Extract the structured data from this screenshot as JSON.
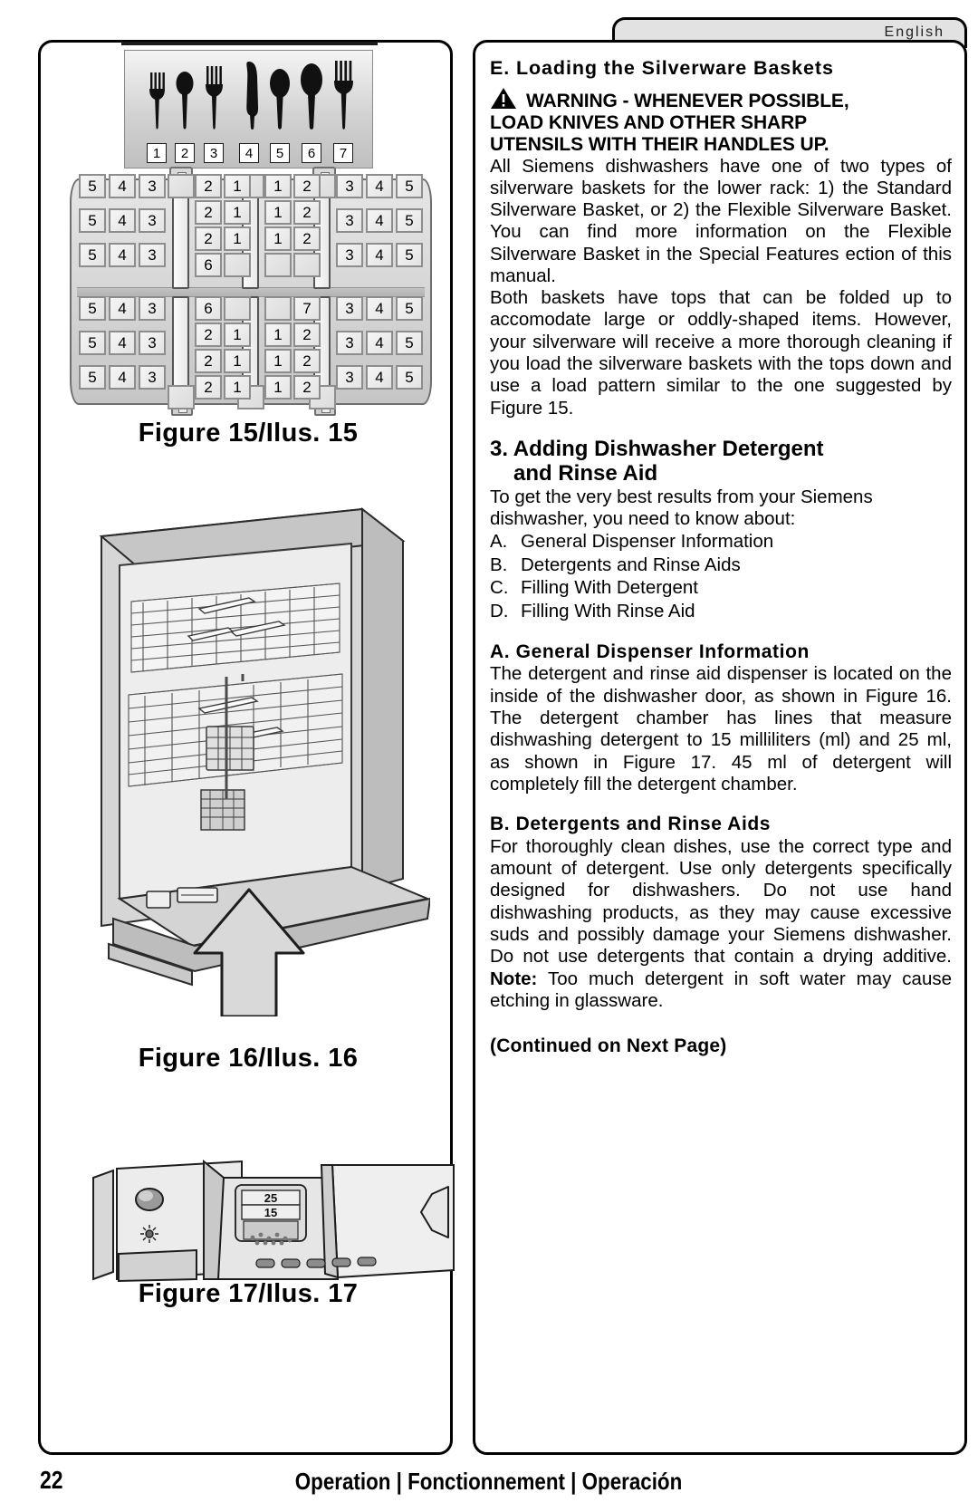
{
  "language_tab": {
    "label": "English"
  },
  "left_column": {
    "figure15": {
      "caption": "Figure 15/Ilus. 15",
      "utensil_key": {
        "items": [
          {
            "num": "1",
            "type": "fork-small"
          },
          {
            "num": "2",
            "type": "spoon-small"
          },
          {
            "num": "3",
            "type": "fork-medium"
          },
          {
            "num": "4",
            "type": "knife"
          },
          {
            "num": "5",
            "type": "spoon-medium"
          },
          {
            "num": "6",
            "type": "spoon-large"
          },
          {
            "num": "7",
            "type": "fork-large"
          }
        ]
      },
      "basket_layout": {
        "description": "Suggested silverware load pattern, numbers refer to utensil key",
        "top_half": {
          "left_block": [
            [
              "5",
              "4",
              "3"
            ],
            [
              "5",
              "4",
              "3"
            ],
            [
              "5",
              "4",
              "3"
            ]
          ],
          "inner_left_block": [
            [
              "2",
              "1"
            ],
            [
              "2",
              "1"
            ],
            [
              "2",
              "1"
            ],
            [
              "6",
              ""
            ]
          ],
          "inner_right_block": [
            [
              "1",
              "2"
            ],
            [
              "1",
              "2"
            ],
            [
              "1",
              "2"
            ],
            [
              "",
              ""
            ]
          ],
          "right_block": [
            [
              "3",
              "4",
              "5"
            ],
            [
              "3",
              "4",
              "5"
            ],
            [
              "3",
              "4",
              "5"
            ]
          ]
        },
        "bottom_half": {
          "left_block": [
            [
              "5",
              "4",
              "3"
            ],
            [
              "5",
              "4",
              "3"
            ],
            [
              "5",
              "4",
              "3"
            ]
          ],
          "inner_left_block": [
            [
              "6",
              ""
            ],
            [
              "2",
              "1"
            ],
            [
              "2",
              "1"
            ],
            [
              "2",
              "1"
            ]
          ],
          "inner_right_block": [
            [
              "",
              "7"
            ],
            [
              "1",
              "2"
            ],
            [
              "1",
              "2"
            ],
            [
              "1",
              "2"
            ]
          ],
          "right_block": [
            [
              "3",
              "4",
              "5"
            ],
            [
              "3",
              "4",
              "5"
            ],
            [
              "3",
              "4",
              "5"
            ]
          ]
        }
      }
    },
    "figure16": {
      "caption": "Figure 16/Ilus. 16",
      "alt": "Open dishwasher with lower and upper racks, arrow pointing to door"
    },
    "figure17": {
      "caption": "Figure 17/Ilus. 17",
      "alt": "Detergent and rinse aid dispenser detail",
      "markings": [
        "25",
        "15"
      ]
    }
  },
  "right_column": {
    "section_e_title": "E. Loading the Silverware Baskets",
    "warning": {
      "icon": "warning-triangle-icon",
      "line1": "WARNING -  WHENEVER POSSIBLE,",
      "line2": "LOAD KNIVES AND OTHER SHARP",
      "line3": "UTENSILS WITH THEIR HANDLES UP."
    },
    "paragraph1": "All Siemens dishwashers have one of two types of silverware baskets for the lower rack: 1) the Standard Silverware Basket, or 2) the Flexible Silverware Basket. You can find more information on the Flexible Silverware Basket in the Special Features ection of this manual.",
    "paragraph2": "Both baskets have tops that can be folded up to accomodate large or oddly-shaped items. However, your silverware will receive a more thorough cleaning if you load the silverware baskets with the tops down and use a load pattern similar to the one suggested by Figure 15.",
    "section3": {
      "title_line1": "3. Adding Dishwasher Detergent",
      "title_line2": "and Rinse Aid",
      "intro": "To get the very best results from your Siemens dishwasher, you need to know about:",
      "list": [
        {
          "key": "A.",
          "label": "General Dispenser Information"
        },
        {
          "key": "B.",
          "label": "Detergents and Rinse Aids"
        },
        {
          "key": "C.",
          "label": "Filling With Detergent"
        },
        {
          "key": "D.",
          "label": "Filling With Rinse Aid"
        }
      ]
    },
    "subsection_a": {
      "title": "A.  General Dispenser Information",
      "body": "The detergent and rinse aid dispenser is located on the inside of the dishwasher door, as shown in Figure 16. The detergent chamber has lines that measure dishwashing detergent to 15 milliliters (ml) and 25 ml, as shown in Figure 17. 45 ml of detergent will completely fill the detergent chamber."
    },
    "subsection_b": {
      "title": "B. Detergents and Rinse Aids",
      "body_part1": "  For thoroughly clean dishes, use the correct type and amount of detergent. Use only detergents specifically designed for dishwashers. Do not use hand dishwashing products, as they may cause excessive suds and possibly damage your Siemens dishwasher. Do not use detergents that contain a drying additive. ",
      "note_label": "Note:",
      "body_part2": " Too much detergent in soft water may cause etching in glassware."
    },
    "continued": "(Continued on Next Page)"
  },
  "footer": {
    "page_number": "22",
    "titles": "Operation  |  Fonctionnement  |  Operación"
  }
}
